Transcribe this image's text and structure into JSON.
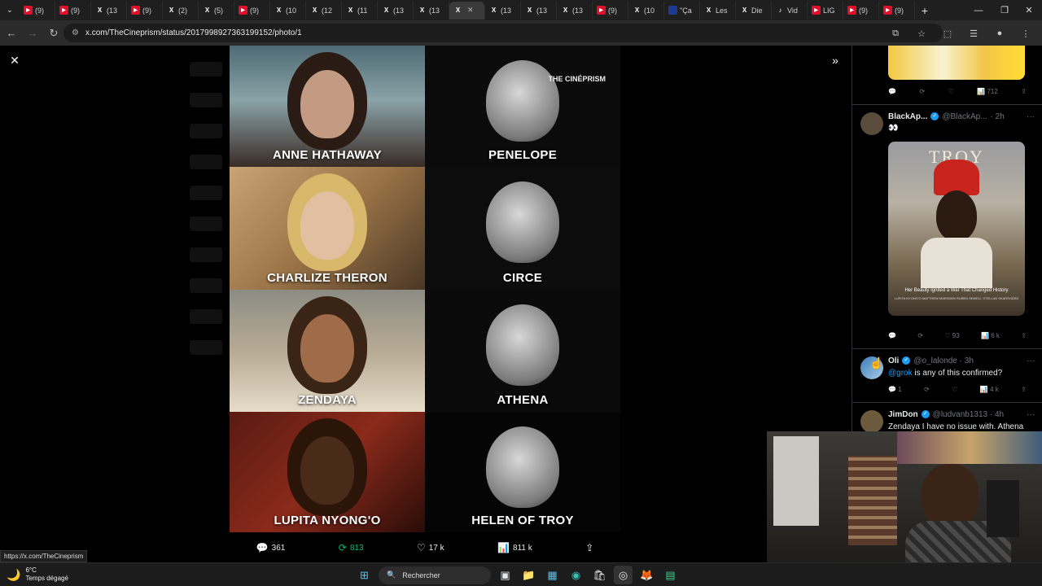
{
  "tabs": [
    {
      "icon": "youtube-icon",
      "label": "(9)",
      "type": "yt"
    },
    {
      "icon": "youtube-icon",
      "label": "(9)",
      "type": "yt"
    },
    {
      "icon": "x-logo-icon",
      "label": "(13",
      "type": "x"
    },
    {
      "icon": "youtube-icon",
      "label": "(9)",
      "type": "yt"
    },
    {
      "icon": "x-logo-icon",
      "label": "(2)",
      "type": "x"
    },
    {
      "icon": "x-logo-icon",
      "label": "(5)",
      "type": "x"
    },
    {
      "icon": "youtube-icon",
      "label": "(9)",
      "type": "yt"
    },
    {
      "icon": "x-logo-icon",
      "label": "(10",
      "type": "x"
    },
    {
      "icon": "x-logo-icon",
      "label": "(12",
      "type": "x"
    },
    {
      "icon": "x-logo-icon",
      "label": "(11",
      "type": "x"
    },
    {
      "icon": "x-logo-icon",
      "label": "(13",
      "type": "x"
    },
    {
      "icon": "x-logo-icon",
      "label": "(13",
      "type": "x"
    },
    {
      "icon": "x-logo-icon",
      "label": "",
      "type": "x",
      "active": true
    },
    {
      "icon": "x-logo-icon",
      "label": "(13",
      "type": "x"
    },
    {
      "icon": "x-logo-icon",
      "label": "(13",
      "type": "x"
    },
    {
      "icon": "x-logo-icon",
      "label": "(13",
      "type": "x"
    },
    {
      "icon": "youtube-icon",
      "label": "(9)",
      "type": "yt"
    },
    {
      "icon": "x-logo-icon",
      "label": "(10",
      "type": "x"
    },
    {
      "icon": "french-flag-icon",
      "label": "\"Ça",
      "type": "fr"
    },
    {
      "icon": "x-logo-icon",
      "label": "Les",
      "type": "x"
    },
    {
      "icon": "x-logo-icon",
      "label": "Die",
      "type": "x"
    },
    {
      "icon": "tiktok-icon",
      "label": "Vid",
      "type": "tk"
    },
    {
      "icon": "youtube-icon",
      "label": "LIG",
      "type": "yt"
    },
    {
      "icon": "youtube-icon",
      "label": "(9)",
      "type": "yt"
    },
    {
      "icon": "youtube-icon",
      "label": "(9)",
      "type": "yt"
    }
  ],
  "address": {
    "url": "x.com/TheCineprism/status/2017998927363199152/photo/1"
  },
  "grid": {
    "brand": "THE CINÉPRISM",
    "cells": [
      {
        "name": "ANNE HATHAWAY",
        "kind": "actress"
      },
      {
        "name": "PENELOPE",
        "kind": "statue"
      },
      {
        "name": "CHARLIZE THERON",
        "kind": "actress"
      },
      {
        "name": "CIRCE",
        "kind": "statue"
      },
      {
        "name": "ZENDAYA",
        "kind": "actress"
      },
      {
        "name": "ATHENA",
        "kind": "statue"
      },
      {
        "name": "LUPITA NYONG'O",
        "kind": "actress"
      },
      {
        "name": "HELEN OF TROY",
        "kind": "statue"
      }
    ]
  },
  "actions": {
    "replies": "361",
    "reposts": "813",
    "likes": "17 k",
    "views": "811 k"
  },
  "status_url": "https://x.com/TheCineprism",
  "feed": {
    "first_views": "712",
    "tweet1": {
      "name": "BlackAp...",
      "handle": "@BlackAp...",
      "time": "· 2h",
      "body": "👀",
      "image_title": "TROY",
      "image_tagline": "Her Beauty Ignited a War That Changed History",
      "image_credits": "LUPITA NYONG'O   MATTHEW MARSDEN   RUBEN SEWELL   STELLAN SKARSGÅRD",
      "likes": "93",
      "views": "6 k"
    },
    "tweet2": {
      "name": "Oli",
      "handle": "@o_lalonde · 3h",
      "mention": "@grok",
      "body": " is any of this confirmed?",
      "replies": "1",
      "views": "4 k"
    },
    "tweet3": {
      "name": "JimDon",
      "handle": "@ludvanb1313 · 4h",
      "body": "Zendaya I have no issue with. Athena"
    }
  },
  "taskbar": {
    "temp": "6°C",
    "weather": "Temps dégagé",
    "search_placeholder": "Rechercher"
  }
}
